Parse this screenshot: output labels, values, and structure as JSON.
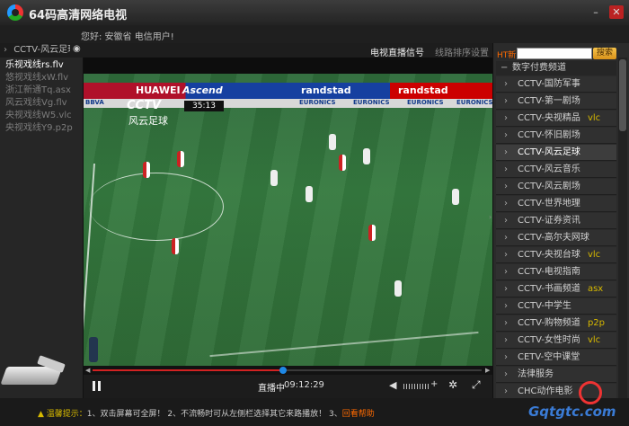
{
  "window": {
    "title": "64码高清网络电视",
    "minimize": "–",
    "close": "✕"
  },
  "greeting": "您好: 安徽省 电信用户!",
  "left_panel": {
    "header": "CCTV-风云足球",
    "items": [
      {
        "label": "乐视戏线rs.flv",
        "active": true
      },
      {
        "label": "悠视戏线xW.flv",
        "active": false
      },
      {
        "label": "浙江新通Tq.asx",
        "active": false
      },
      {
        "label": "风云戏线Vg.flv",
        "active": false
      },
      {
        "label": "央视戏线W5.vlc",
        "active": false
      },
      {
        "label": "央视戏线Y9.p2p",
        "active": false
      }
    ]
  },
  "right_tabs": {
    "live": "电视直播信号",
    "sort": "线路排序设置"
  },
  "search": {
    "label": "HT新",
    "placeholder": "",
    "button": "搜索"
  },
  "channel_group": "数字付费频道",
  "channels": [
    {
      "name": "CCTV-国防军事",
      "tag": ""
    },
    {
      "name": "CCTV-第一剧场",
      "tag": ""
    },
    {
      "name": "CCTV-央视精品",
      "tag": "vlc"
    },
    {
      "name": "CCTV-怀旧剧场",
      "tag": ""
    },
    {
      "name": "CCTV-风云足球",
      "tag": "",
      "selected": true
    },
    {
      "name": "CCTV-风云音乐",
      "tag": ""
    },
    {
      "name": "CCTV-风云剧场",
      "tag": ""
    },
    {
      "name": "CCTV-世界地理",
      "tag": ""
    },
    {
      "name": "CCTV-证券资讯",
      "tag": ""
    },
    {
      "name": "CCTV-高尔夫网球",
      "tag": ""
    },
    {
      "name": "CCTV-央视台球",
      "tag": "vlc"
    },
    {
      "name": "CCTV-电视指南",
      "tag": ""
    },
    {
      "name": "CCTV-书画频道",
      "tag": "asx"
    },
    {
      "name": "CCTV-中学生",
      "tag": ""
    },
    {
      "name": "CCTV-购物频道",
      "tag": "p2p"
    },
    {
      "name": "CCTV-女性时尚",
      "tag": "vlc"
    },
    {
      "name": "CETV-空中课堂",
      "tag": ""
    },
    {
      "name": "法律服务",
      "tag": ""
    },
    {
      "name": "CHC动作电影",
      "tag": ""
    }
  ],
  "video": {
    "broadcast_logo": "CCTV",
    "broadcast_sub": "风云足球",
    "score_clock": "35:13",
    "ads": [
      "HUAWEI",
      "Ascend",
      "randstad",
      "randstad"
    ],
    "ads_small": [
      "BBVA",
      "EURONICS",
      "EURONICS",
      "EURONICS",
      "EURONICS"
    ]
  },
  "player": {
    "status": "直播中",
    "time": "09:12:29",
    "progress_fraction": 0.49
  },
  "tips": {
    "prefix": "▲ 温馨提示：",
    "text": "1、双击屏幕可全屏！ 2、不流畅时可从左侧栏选择其它来路播放！ 3、",
    "link": "回看帮助"
  },
  "watermark": "Gqtgtc.com",
  "colors": {
    "accent_orange": "#ff6a00",
    "tag_yellow": "#d7b900",
    "search_button": "#f0b030",
    "progress_red": "#d22222",
    "progress_handle": "#1e88e5"
  }
}
